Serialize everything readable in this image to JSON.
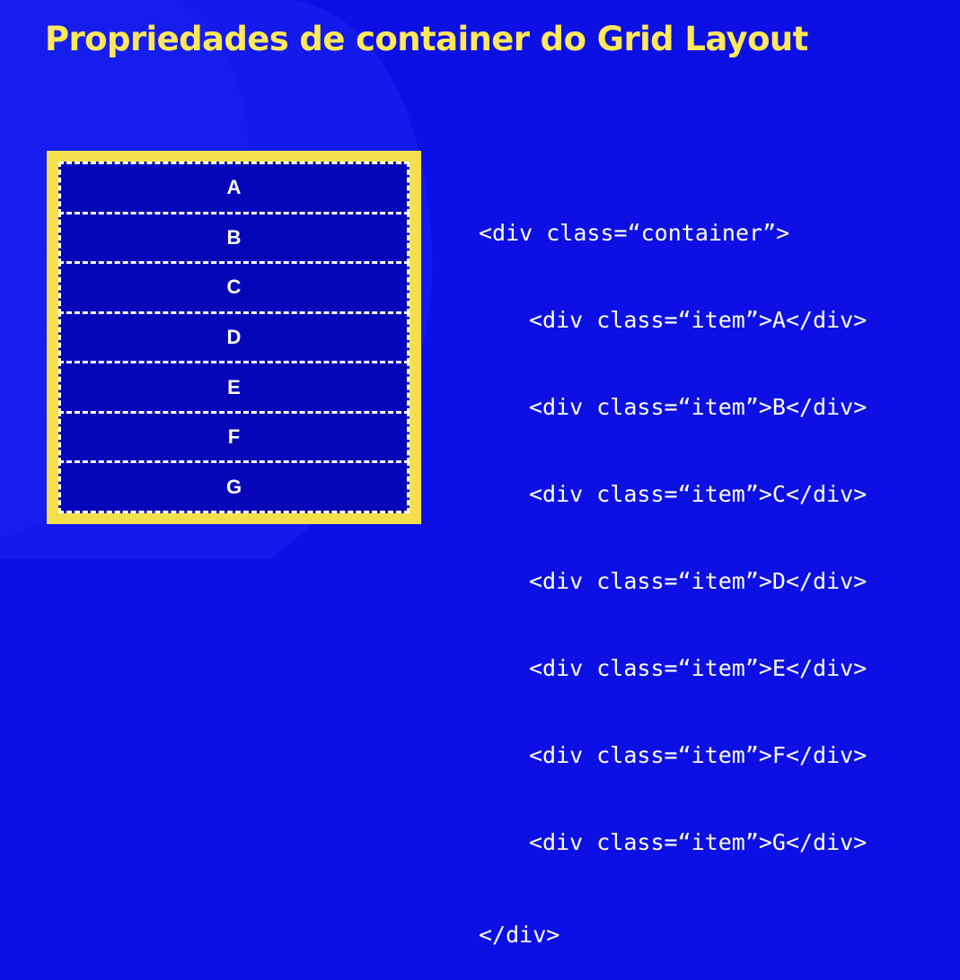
{
  "slide": {
    "title": "Propriedades de container do Grid Layout"
  },
  "colors": {
    "background": "#0d10e4",
    "background_shape": "#1a22f0",
    "title": "#ffe85a",
    "container_border": "#f4e04a",
    "item_fill": "#0606b8",
    "item_border": "#ffffff",
    "code_text": "#ffffff"
  },
  "grid_demo": {
    "items": [
      "A",
      "B",
      "C",
      "D",
      "E",
      "F",
      "G"
    ]
  },
  "code": {
    "open_tag": "<div class=“container”>",
    "item_lines": [
      "<div class=“item”>A</div>",
      "<div class=“item”>B</div>",
      "<div class=“item”>C</div>",
      "<div class=“item”>D</div>",
      "<div class=“item”>E</div>",
      "<div class=“item”>F</div>",
      "<div class=“item”>G</div>"
    ],
    "close_tag": "</div>"
  }
}
